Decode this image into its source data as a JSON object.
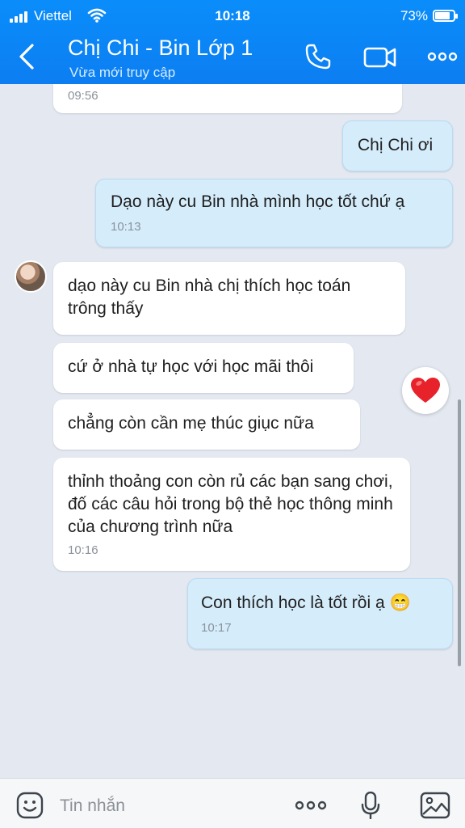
{
  "status_bar": {
    "carrier": "Viettel",
    "time": "10:18",
    "battery": "73%",
    "battery_level": 0.73
  },
  "header": {
    "title": "Chị Chi - Bin Lớp 1",
    "subtitle": "Vừa mới truy cập"
  },
  "messages": [
    {
      "id": "m0",
      "dir": "in",
      "text": "",
      "time": "09:56"
    },
    {
      "id": "m1",
      "dir": "out",
      "text": "Chị Chi ơi",
      "time": ""
    },
    {
      "id": "m2",
      "dir": "out",
      "text": "Dạo này cu Bin nhà mình học tốt chứ ạ",
      "time": "10:13"
    },
    {
      "id": "m3",
      "dir": "in",
      "text": "dạo này cu Bin nhà chị thích học toán trông thấy",
      "time": ""
    },
    {
      "id": "m4",
      "dir": "in",
      "text": "cứ ở nhà tự học với học mãi thôi",
      "time": ""
    },
    {
      "id": "m5",
      "dir": "in",
      "text": "chẳng còn cần mẹ thúc giục nữa",
      "time": ""
    },
    {
      "id": "m6",
      "dir": "in",
      "text": "thỉnh thoảng con còn rủ các bạn sang chơi, đố các câu hỏi trong bộ thẻ học thông minh của chương trình nữa",
      "time": "10:16"
    },
    {
      "id": "m7",
      "dir": "out",
      "text": "Con thích học là tốt rồi ạ 😁",
      "time": "10:17"
    }
  ],
  "reaction": {
    "icon": "heart-icon",
    "color": "#e8222a"
  },
  "input": {
    "placeholder": "Tin nhắn"
  },
  "colors": {
    "header": "#0a8dfa",
    "chat_bg": "#e3e8f1",
    "outgoing_bubble": "#d5ecfb",
    "incoming_bubble": "#ffffff"
  }
}
